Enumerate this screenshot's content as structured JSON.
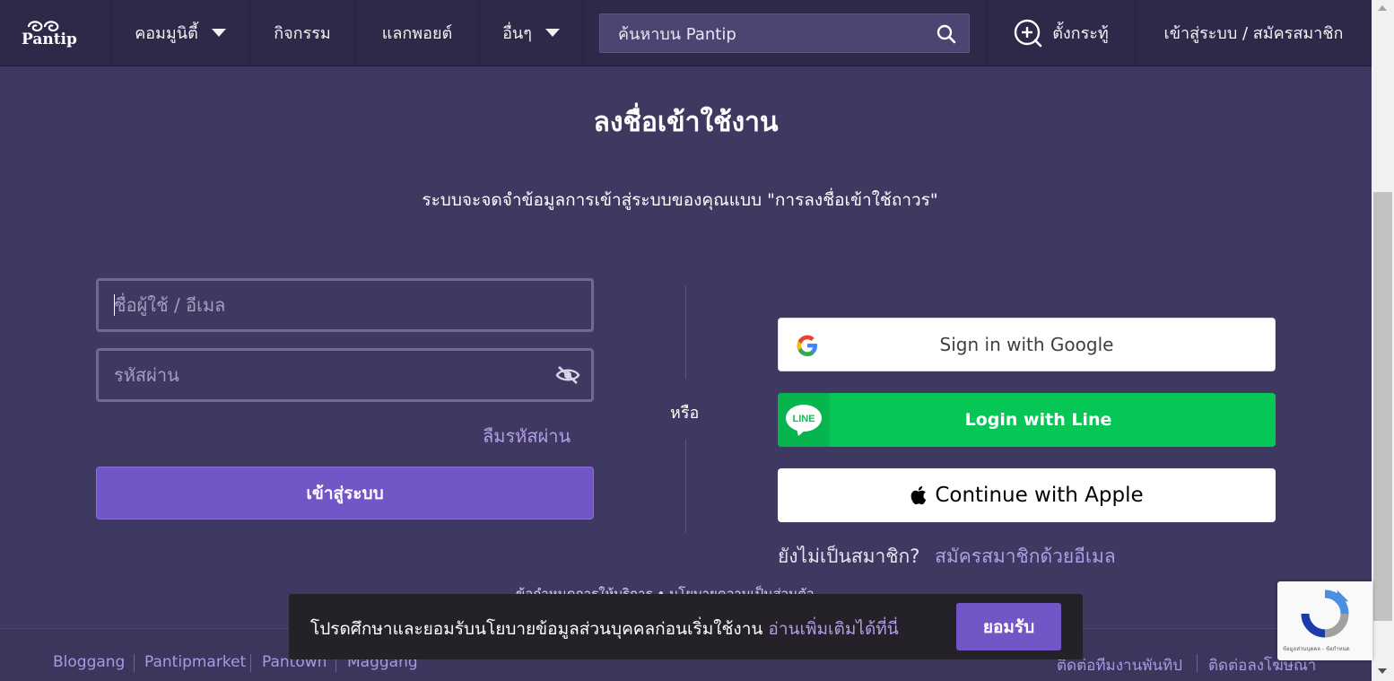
{
  "nav": {
    "logo_text": "Pantip",
    "items": [
      {
        "label": "คอมมูนิตี้"
      },
      {
        "label": "กิจกรรม"
      },
      {
        "label": "แลกพอยต์"
      },
      {
        "label": "อื่นๆ"
      }
    ],
    "search_placeholder": "ค้นหาบน Pantip",
    "new_topic_label": "ตั้งกระทู้",
    "login_label": "เข้าสู่ระบบ / สมัครสมาชิก"
  },
  "main": {
    "title": "ลงชื่อเข้าใช้งาน",
    "subtitle": "ระบบจะจดจำข้อมูลการเข้าสู่ระบบของคุณแบบ \"การลงชื่อเข้าใช้ถาวร\"",
    "username_placeholder": "ชื่อผู้ใช้ / อีเมล",
    "password_placeholder": "รหัสผ่าน",
    "forgot_password": "ลืมรหัสผ่าน",
    "login_button": "เข้าสู่ระบบ",
    "or_label": "หรือ",
    "google_button": "Sign in with Google",
    "line_button": "Login with Line",
    "line_logo_text": "LINE",
    "apple_button": "Continue with Apple",
    "not_member": "ยังไม่เป็นสมาชิก?",
    "register_link": "สมัครสมาชิกด้วยอีเมล",
    "terms_text": "ข้อกำหนดการให้บริการ  •  นโยบายความเป็นส่วนตัว"
  },
  "footer": {
    "links": [
      "Bloggang",
      "Pantipmarket",
      "Pantown",
      "Maggang"
    ],
    "right_links": [
      "ติดต่อทีมงานพันทิป",
      "ติดต่อลงโฆษณา"
    ]
  },
  "consent": {
    "text": "โปรดศึกษาและยอมรับนโยบายข้อมูลส่วนบุคคลก่อนเริ่มใช้งาน",
    "link": "อ่านเพิ่มเติมได้ที่นี่",
    "accept": "ยอมรับ"
  },
  "recaptcha": {
    "text": "ข้อมูลส่วนบุคคล - ข้อกำหนด"
  },
  "colors": {
    "background": "#3d3960",
    "navbar": "#2d2a49",
    "accent": "#7255c6",
    "link": "#b39de6",
    "line_green": "#06c755"
  },
  "icons": [
    "search-icon",
    "new-topic-icon",
    "eye-off-icon",
    "google-icon",
    "line-icon",
    "apple-icon",
    "caret-down-icon",
    "recaptcha-icon"
  ]
}
